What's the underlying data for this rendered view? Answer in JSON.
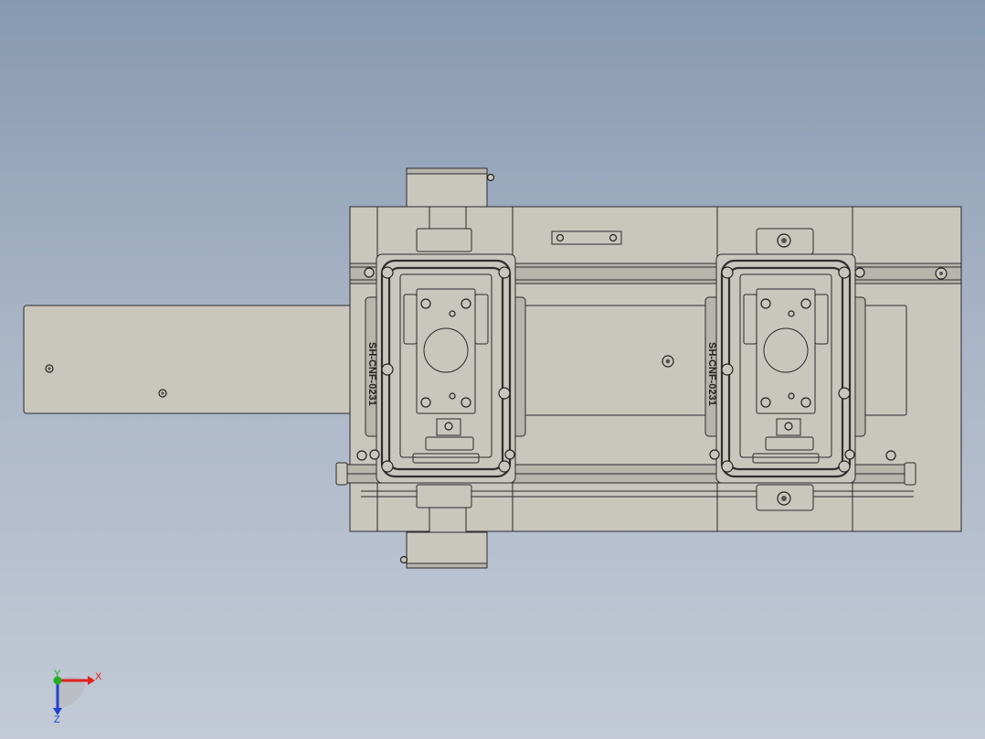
{
  "viewport": {
    "background_top": "#8799b1",
    "background_bottom": "#c3cad6"
  },
  "part_colors": {
    "body": "#c8c6bd",
    "body_dark": "#a9a79e",
    "edge": "#2b2b2b",
    "gasket": "#3a3a3a"
  },
  "fixture": {
    "engraving_left": "SH-CNF-0231",
    "engraving_right": "SH-CNF-0231"
  },
  "triad": {
    "x_label": "X",
    "y_label": "Y",
    "z_label": "Z",
    "x_color": "#e02020",
    "y_color": "#20b020",
    "z_color": "#2040d0"
  }
}
